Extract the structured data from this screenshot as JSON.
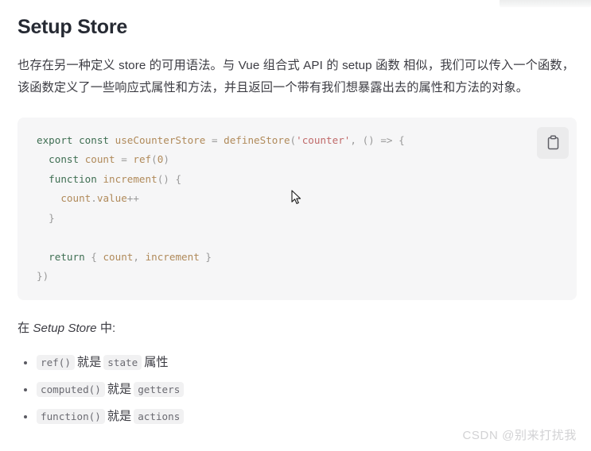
{
  "page": {
    "title": "Setup Store",
    "intro": "也存在另一种定义 store 的可用语法。与 Vue 组合式 API 的 setup 函数 相似，我们可以传入一个函数，该函数定义了一些响应式属性和方法，并且返回一个带有我们想暴露出去的属性和方法的对象。"
  },
  "code_block": {
    "language": "javascript",
    "copy_button_label": "",
    "copy_icon": "clipboard-icon",
    "lines": [
      "export const useCounterStore = defineStore('counter', () => {",
      "  const count = ref(0)",
      "  function increment() {",
      "    count.value++",
      "  }",
      "",
      "  return { count, increment }",
      "})"
    ],
    "tokens": {
      "keywords": [
        "export",
        "const",
        "function",
        "return"
      ],
      "identifiers": [
        "useCounterStore",
        "defineStore",
        "count",
        "ref",
        "increment",
        "value"
      ],
      "strings": [
        "'counter'"
      ],
      "numbers": [
        "0"
      ]
    },
    "colors": {
      "background": "#f6f6f7",
      "keyword": "#3e6e52",
      "identifier": "#b08a5a",
      "string": "#c06a6a",
      "punctuation": "#999999",
      "button_background": "#ebebec"
    }
  },
  "mid_paragraph": {
    "prefix": "在 ",
    "emphasis": "Setup Store",
    "suffix": " 中:"
  },
  "bullets": [
    {
      "code1": "ref()",
      "text": "就是",
      "code2": "state",
      "suffix": "属性"
    },
    {
      "code1": "computed()",
      "text": "就是",
      "code2": "getters",
      "suffix": ""
    },
    {
      "code1": "function()",
      "text": "就是",
      "code2": "actions",
      "suffix": ""
    }
  ],
  "watermark": {
    "text": "CSDN @别来打扰我"
  }
}
